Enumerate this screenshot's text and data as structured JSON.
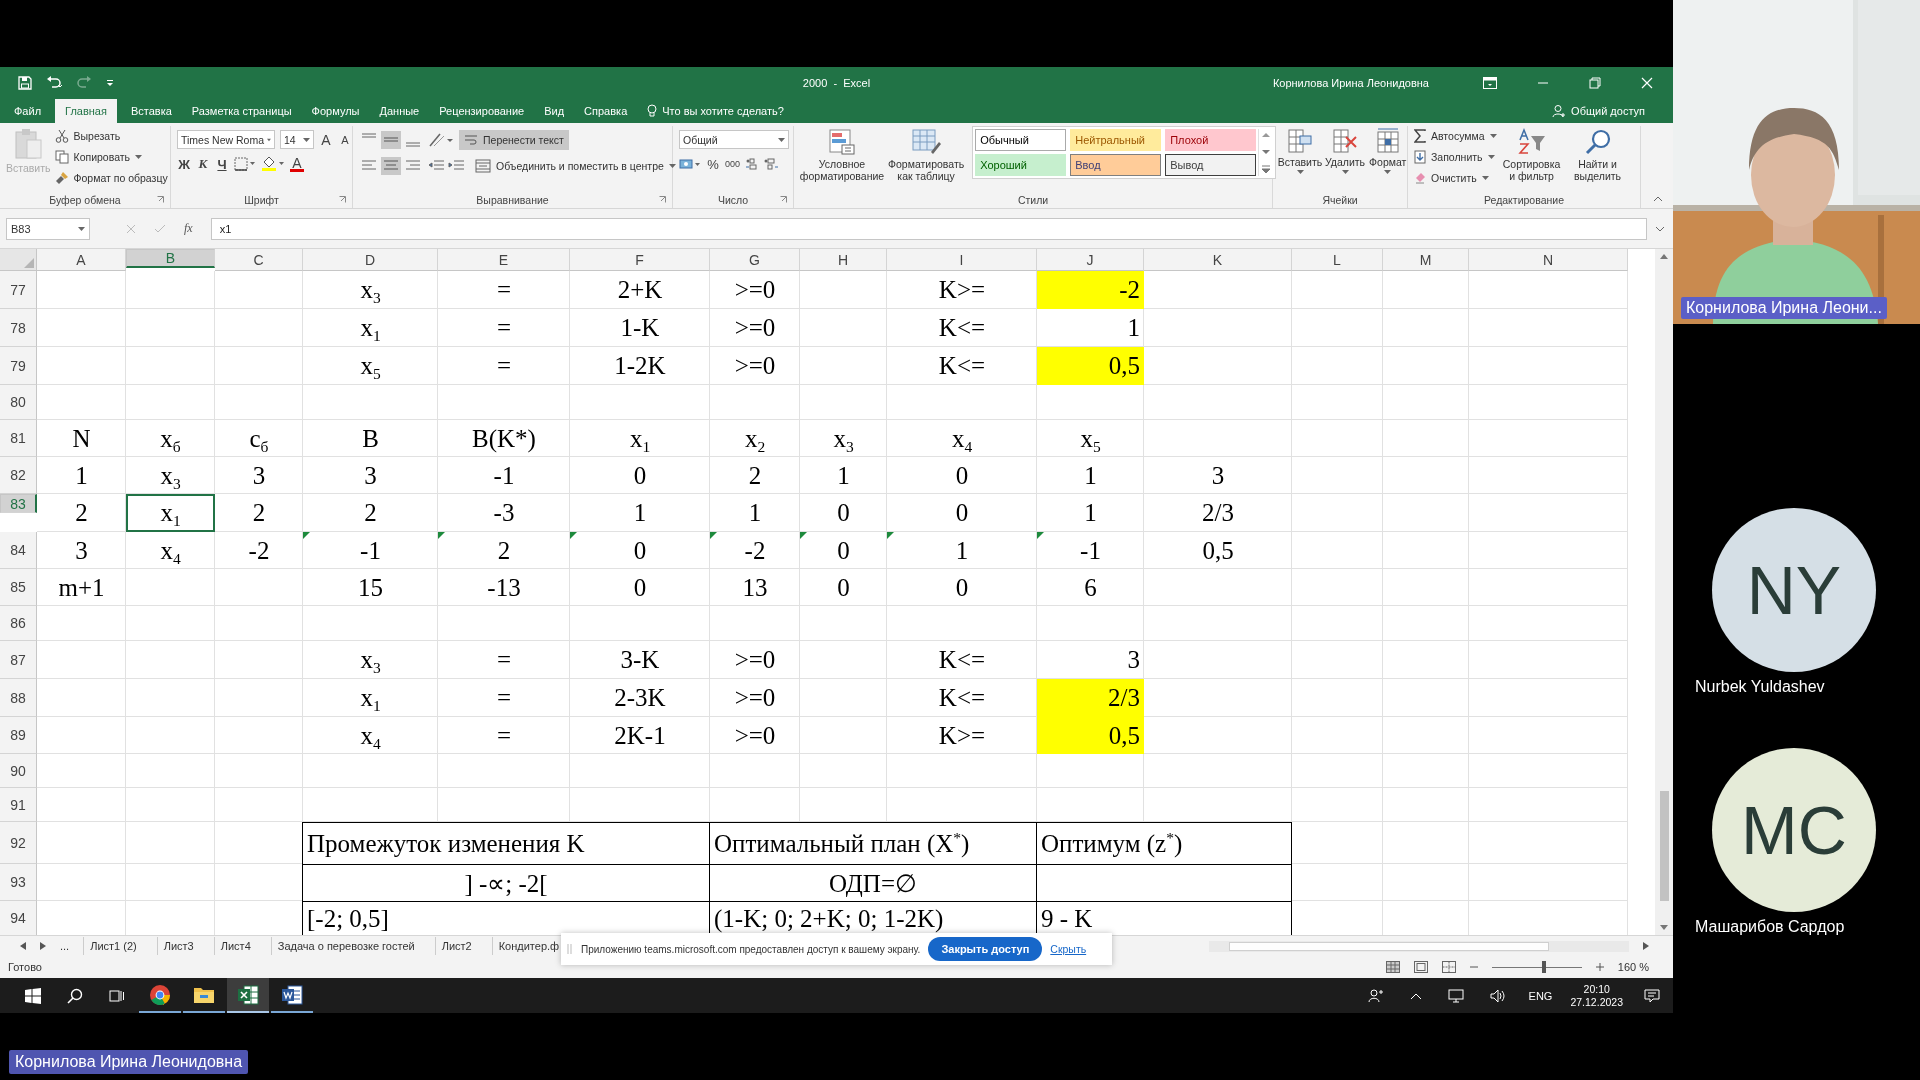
{
  "window": {
    "title": "2000  -  Excel",
    "user": "Корнилова Ирина Леонидовна"
  },
  "ribbon_tabs": [
    {
      "label": "Файл",
      "selected": false
    },
    {
      "label": "Главная",
      "selected": true
    },
    {
      "label": "Вставка",
      "selected": false
    },
    {
      "label": "Разметка страницы",
      "selected": false
    },
    {
      "label": "Формулы",
      "selected": false
    },
    {
      "label": "Данные",
      "selected": false
    },
    {
      "label": "Рецензирование",
      "selected": false
    },
    {
      "label": "Вид",
      "selected": false
    },
    {
      "label": "Справка",
      "selected": false
    }
  ],
  "tell_me": "Что вы хотите сделать?",
  "share": "Общий доступ",
  "ribbon": {
    "clipboard": {
      "label": "Буфер обмена",
      "paste": "Вставить",
      "cut": "Вырезать",
      "copy": "Копировать",
      "painter": "Формат по образцу"
    },
    "font": {
      "label": "Шрифт",
      "family": "Times New Roma",
      "size": "14",
      "grow": "A",
      "shrink": "A",
      "bold": "Ж",
      "italic": "К",
      "underline": "Ч",
      "color_letter": "A"
    },
    "alignment": {
      "label": "Выравнивание",
      "wrap": "Перенести текст",
      "wrap_on": true,
      "merge": "Объединить и поместить в центре"
    },
    "number": {
      "label": "Число",
      "format": "Общий",
      "percent": "%",
      "thousands": "000"
    },
    "styles": {
      "label": "Стили",
      "conditional": "Условное форматирование",
      "as_table": "Форматировать как таблицу",
      "gallery": [
        {
          "label": "Обычный",
          "kind": "normal"
        },
        {
          "label": "Нейтральный",
          "kind": "neutral"
        },
        {
          "label": "Плохой",
          "kind": "bad"
        },
        {
          "label": "Хороший",
          "kind": "good"
        },
        {
          "label": "Ввод",
          "kind": "input"
        },
        {
          "label": "Вывод",
          "kind": "output"
        }
      ]
    },
    "cells": {
      "label": "Ячейки",
      "insert": "Вставить",
      "delete": "Удалить",
      "format": "Формат"
    },
    "editing": {
      "label": "Редактирование",
      "autosum": "Автосумма",
      "fill": "Заполнить",
      "clear": "Очистить",
      "sort": "Сортировка и фильтр",
      "find": "Найти и выделить"
    }
  },
  "formula_bar": {
    "name_box": "B83",
    "fx": "fx",
    "value": "x1"
  },
  "sheet": {
    "columns": [
      {
        "label": "A",
        "selected": false
      },
      {
        "label": "B",
        "selected": true
      },
      {
        "label": "C",
        "selected": false
      },
      {
        "label": "D",
        "selected": false
      },
      {
        "label": "E",
        "selected": false
      },
      {
        "label": "F",
        "selected": false
      },
      {
        "label": "G",
        "selected": false
      },
      {
        "label": "H",
        "selected": false
      },
      {
        "label": "I",
        "selected": false
      },
      {
        "label": "J",
        "selected": false
      },
      {
        "label": "K",
        "selected": false
      },
      {
        "label": "L",
        "selected": false
      },
      {
        "label": "M",
        "selected": false
      },
      {
        "label": "N",
        "selected": false
      }
    ],
    "rows": [
      {
        "number": "77",
        "selected": false,
        "cells": [
          null,
          null,
          null,
          {
            "text": "x$_{3}$",
            "kind": "normal"
          },
          {
            "text": "=",
            "kind": "normal"
          },
          {
            "text": "2+K",
            "kind": "normal"
          },
          {
            "text": ">=0",
            "kind": "normal"
          },
          null,
          {
            "text": "K>=",
            "kind": "normal"
          },
          {
            "text": "-2",
            "kind": "highlighted"
          }
        ]
      },
      {
        "number": "78",
        "selected": false,
        "cells": [
          null,
          null,
          null,
          {
            "text": "x$_{1}$",
            "kind": "normal"
          },
          {
            "text": "=",
            "kind": "normal"
          },
          {
            "text": "1-K",
            "kind": "normal"
          },
          {
            "text": ">=0",
            "kind": "normal"
          },
          null,
          {
            "text": "K<=",
            "kind": "normal"
          },
          {
            "text": "1",
            "kind": "number"
          }
        ]
      },
      {
        "number": "79",
        "selected": false,
        "cells": [
          null,
          null,
          null,
          {
            "text": "x$_{5}$",
            "kind": "normal"
          },
          {
            "text": "=",
            "kind": "normal"
          },
          {
            "text": "1-2K",
            "kind": "normal"
          },
          {
            "text": ">=0",
            "kind": "normal"
          },
          null,
          {
            "text": "K<=",
            "kind": "normal"
          },
          {
            "text": "0,5",
            "kind": "highlighted"
          }
        ]
      },
      {
        "number": "80",
        "selected": false
      },
      {
        "number": "81",
        "selected": false,
        "cells": [
          {
            "text": "N",
            "kind": "normal"
          },
          {
            "text": "x$_{б}$",
            "kind": "normal"
          },
          {
            "text": "c$_{б}$",
            "kind": "normal"
          },
          {
            "text": "B",
            "kind": "normal"
          },
          {
            "text": "B(K*)",
            "kind": "normal"
          },
          {
            "text": "x$_{1}$",
            "kind": "normal"
          },
          {
            "text": "x$_{2}$",
            "kind": "normal"
          },
          {
            "text": "x$_{3}$",
            "kind": "normal"
          },
          {
            "text": "x$_{4}$",
            "kind": "normal"
          },
          {
            "text": "x$_{5}$",
            "kind": "normal"
          }
        ]
      },
      {
        "number": "82",
        "selected": false,
        "cells": [
          {
            "text": "1",
            "kind": "normal"
          },
          {
            "text": "x$_{3}$",
            "kind": "normal"
          },
          {
            "text": "3",
            "kind": "normal"
          },
          {
            "text": "3",
            "kind": "normal"
          },
          {
            "text": "-1",
            "kind": "normal"
          },
          {
            "text": "0",
            "kind": "normal"
          },
          {
            "text": "2",
            "kind": "normal"
          },
          {
            "text": "1",
            "kind": "normal"
          },
          {
            "text": "0",
            "kind": "normal"
          },
          {
            "text": "1",
            "kind": "normal"
          },
          {
            "text": "3",
            "kind": "normal"
          }
        ]
      },
      {
        "number": "83",
        "selected": true,
        "cells": [
          {
            "text": "2",
            "kind": "normal"
          },
          {
            "text": "x$_{1}$",
            "kind": "active"
          },
          {
            "text": "2",
            "kind": "normal"
          },
          {
            "text": "2",
            "kind": "normal"
          },
          {
            "text": "-3",
            "kind": "normal"
          },
          {
            "text": "1",
            "kind": "normal"
          },
          {
            "text": "1",
            "kind": "normal"
          },
          {
            "text": "0",
            "kind": "normal"
          },
          {
            "text": "0",
            "kind": "normal"
          },
          {
            "text": "1",
            "kind": "normal"
          },
          {
            "text": "2/3",
            "kind": "normal"
          }
        ]
      },
      {
        "number": "84",
        "selected": false,
        "cells": [
          {
            "text": "3",
            "kind": "normal"
          },
          {
            "text": "x$_{4}$",
            "kind": "normal"
          },
          {
            "text": "-2",
            "kind": "normal"
          },
          {
            "text": "-1",
            "kind": "flagged"
          },
          {
            "text": "2",
            "kind": "flagged"
          },
          {
            "text": "0",
            "kind": "flagged"
          },
          {
            "text": "-2",
            "kind": "flagged"
          },
          {
            "text": "0",
            "kind": "flagged"
          },
          {
            "text": "1",
            "kind": "flagged"
          },
          {
            "text": "-1",
            "kind": "flagged"
          },
          {
            "text": "0,5",
            "kind": "normal"
          }
        ]
      },
      {
        "number": "85",
        "selected": false,
        "cells": [
          {
            "text": "m+1",
            "kind": "normal"
          },
          null,
          null,
          {
            "text": "15",
            "kind": "normal"
          },
          {
            "text": "-13",
            "kind": "normal"
          },
          {
            "text": "0",
            "kind": "normal"
          },
          {
            "text": "13",
            "kind": "normal"
          },
          {
            "text": "0",
            "kind": "normal"
          },
          {
            "text": "0",
            "kind": "normal"
          },
          {
            "text": "6",
            "kind": "normal"
          }
        ]
      },
      {
        "number": "86",
        "selected": false
      },
      {
        "number": "87",
        "selected": false,
        "cells": [
          null,
          null,
          null,
          {
            "text": "x$_{3}$",
            "kind": "normal"
          },
          {
            "text": "=",
            "kind": "normal"
          },
          {
            "text": "3-K",
            "kind": "normal"
          },
          {
            "text": ">=0",
            "kind": "normal"
          },
          null,
          {
            "text": "K<=",
            "kind": "normal"
          },
          {
            "text": "3",
            "kind": "number"
          }
        ]
      },
      {
        "number": "88",
        "selected": false,
        "cells": [
          null,
          null,
          null,
          {
            "text": "x$_{1}$",
            "kind": "normal"
          },
          {
            "text": "=",
            "kind": "normal"
          },
          {
            "text": "2-3K",
            "kind": "normal"
          },
          {
            "text": ">=0",
            "kind": "normal"
          },
          null,
          {
            "text": "K<=",
            "kind": "normal"
          },
          {
            "text": "2/3",
            "kind": "highlighted"
          }
        ]
      },
      {
        "number": "89",
        "selected": false,
        "cells": [
          null,
          null,
          null,
          {
            "text": "x$_{4}$",
            "kind": "normal"
          },
          {
            "text": "=",
            "kind": "normal"
          },
          {
            "text": "2K-1",
            "kind": "normal"
          },
          {
            "text": ">=0",
            "kind": "normal"
          },
          null,
          {
            "text": "K>=",
            "kind": "normal"
          },
          {
            "text": "0,5",
            "kind": "highlighted"
          }
        ]
      },
      {
        "number": "90",
        "selected": false
      },
      {
        "number": "91",
        "selected": false
      },
      {
        "number": "92",
        "selected": false
      },
      {
        "number": "93",
        "selected": false
      },
      {
        "number": "94",
        "selected": false
      }
    ],
    "results_table": {
      "header": [
        "Промежуток изменения K",
        "Оптимальный план (X$^{*}$)",
        "Оптимум (z$^{*}$)"
      ],
      "rows": [
        {
          "kind": "infeasible",
          "interval": "] -∝; -2[",
          "plan": "ОДП=∅"
        },
        {
          "kind": "feasible",
          "interval": "[-2; 0,5]",
          "plan": "(1-K; 0; 2+K; 0; 1-2K)",
          "optimum": "9 - K"
        }
      ]
    }
  },
  "sheet_tabs": {
    "more": "...",
    "tabs": [
      {
        "label": "Лист1 (2)",
        "selected": false
      },
      {
        "label": "Лист3",
        "selected": false
      },
      {
        "label": "Лист4",
        "selected": false
      },
      {
        "label": "Задача о перевозке гостей",
        "selected": false
      },
      {
        "label": "Лист2",
        "selected": false
      },
      {
        "label": "Кондитер.ф",
        "selected": false
      }
    ]
  },
  "share_notice": {
    "text": "Приложению teams.microsoft.com предоставлен доступ к вашему экрану.",
    "button": "Закрыть доступ",
    "link": "Скрыть"
  },
  "status_bar": {
    "text": "Готово",
    "zoom": {
      "level": 0.58,
      "reading": "160 %"
    }
  },
  "taskbar": {
    "apps": [
      {
        "kind": "chrome",
        "selected": false
      },
      {
        "kind": "explorer",
        "selected": false
      },
      {
        "kind": "excel",
        "selected": true
      },
      {
        "kind": "word",
        "selected": false
      }
    ],
    "language": "ENG",
    "time": "20:10",
    "date": "27.12.2023"
  },
  "meeting": {
    "presenter": "Корнилова Ирина Леони...",
    "participants": [
      {
        "initials": "NY",
        "name": "Nurbek Yuldashev",
        "color": "#d5dfe6"
      },
      {
        "initials": "MC",
        "name": "Машарибов Сардор",
        "color": "#e5ebd8"
      }
    ],
    "sharing_label": "Корнилова Ирина Леонидовна"
  }
}
